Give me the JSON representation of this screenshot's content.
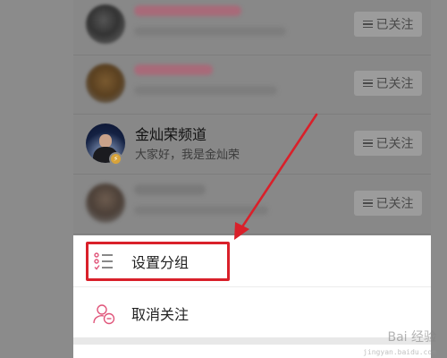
{
  "list": {
    "rows": [
      {
        "name": "",
        "desc": "",
        "button_label": "已关注",
        "blurred": true
      },
      {
        "name": "",
        "desc": "",
        "button_label": "已关注",
        "blurred": true
      },
      {
        "name": "金灿荣频道",
        "desc": "大家好，我是金灿荣",
        "button_label": "已关注",
        "blurred": false,
        "verified": true
      },
      {
        "name": "",
        "desc": "",
        "button_label": "已关注",
        "blurred": true
      }
    ]
  },
  "sheet": {
    "items": [
      {
        "label": "设置分组",
        "icon": "group-list-icon",
        "highlighted": true
      },
      {
        "label": "取消关注",
        "icon": "unfollow-user-icon"
      }
    ]
  },
  "annotation": {
    "arrow_color": "#d9202a",
    "highlight_color": "#d9202a"
  },
  "watermark": {
    "text": "Bai 经验",
    "sub": "jingyan.baidu.com"
  },
  "colors": {
    "overlay": "#888888",
    "accent_pink": "#e0557a",
    "badge": "#d8a33a"
  }
}
